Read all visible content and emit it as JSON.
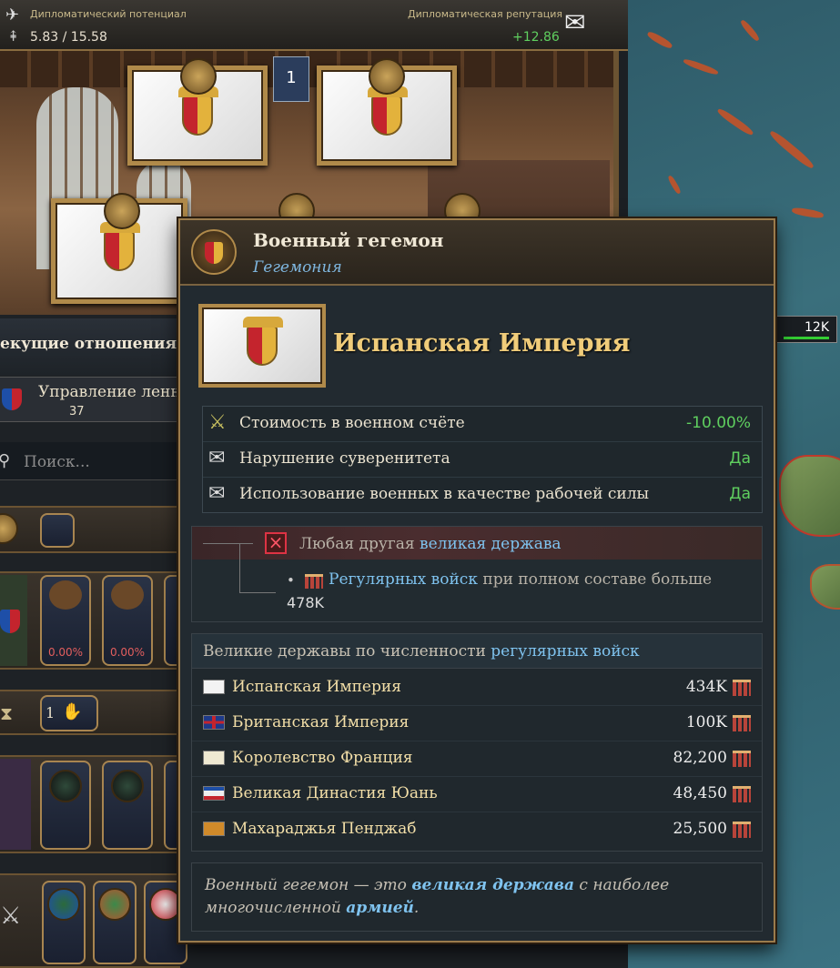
{
  "topbar": {
    "diplo_capacity_label": "Дипломатический потенциал",
    "diplo_capacity_value": "5.83 / 15.58",
    "diplo_reputation_label": "Дипломатическая репутация",
    "diplo_reputation_value": "+12.86",
    "slot_number": "1"
  },
  "left_panel": {
    "relations_header": "екущие отношения",
    "vassal_label": "Управление ленн",
    "vassal_count": "37",
    "search_placeholder": "Поиск...",
    "pct1": "0.00%",
    "pct2": "0.00%",
    "opinion_count": "1"
  },
  "map": {
    "army_label": "12K"
  },
  "tooltip": {
    "title": "Военный гегемон",
    "subtitle": "Гегемония",
    "country": "Испанская Империя",
    "effects": [
      {
        "label": "Стоимость в военном счёте",
        "value": "-10.00%"
      },
      {
        "label": "Нарушение суверенитета",
        "value": "Да"
      },
      {
        "label": "Использование военных в качестве рабочей силы",
        "value": "Да"
      }
    ],
    "condition": {
      "prefix": "Любая другая",
      "link": "великая держава",
      "bullet": "•",
      "sub_link": "Регулярных войск",
      "sub_text": "при полном составе больше",
      "sub_value": "478K"
    },
    "ranking": {
      "header_prefix": "Великие державы по численности",
      "header_link": "регулярных войск",
      "rows": [
        {
          "name": "Испанская Империя",
          "value": "434K"
        },
        {
          "name": "Британская Империя",
          "value": "100K"
        },
        {
          "name": "Королевство Франция",
          "value": "82,200"
        },
        {
          "name": "Великая Династия Юань",
          "value": "48,450"
        },
        {
          "name": "Махараджья Пенджаб",
          "value": "25,500"
        }
      ]
    },
    "description": {
      "part1": "Военный гегемон — это",
      "link1": "великая держава",
      "part2": "с наиболее многочисленной",
      "link2": "армией",
      "part3": "."
    }
  },
  "colors": {
    "positive": "#5fcf5f",
    "link": "#7fc3ef",
    "gold": "#f0cc7a",
    "negative": "#e35e5e"
  }
}
